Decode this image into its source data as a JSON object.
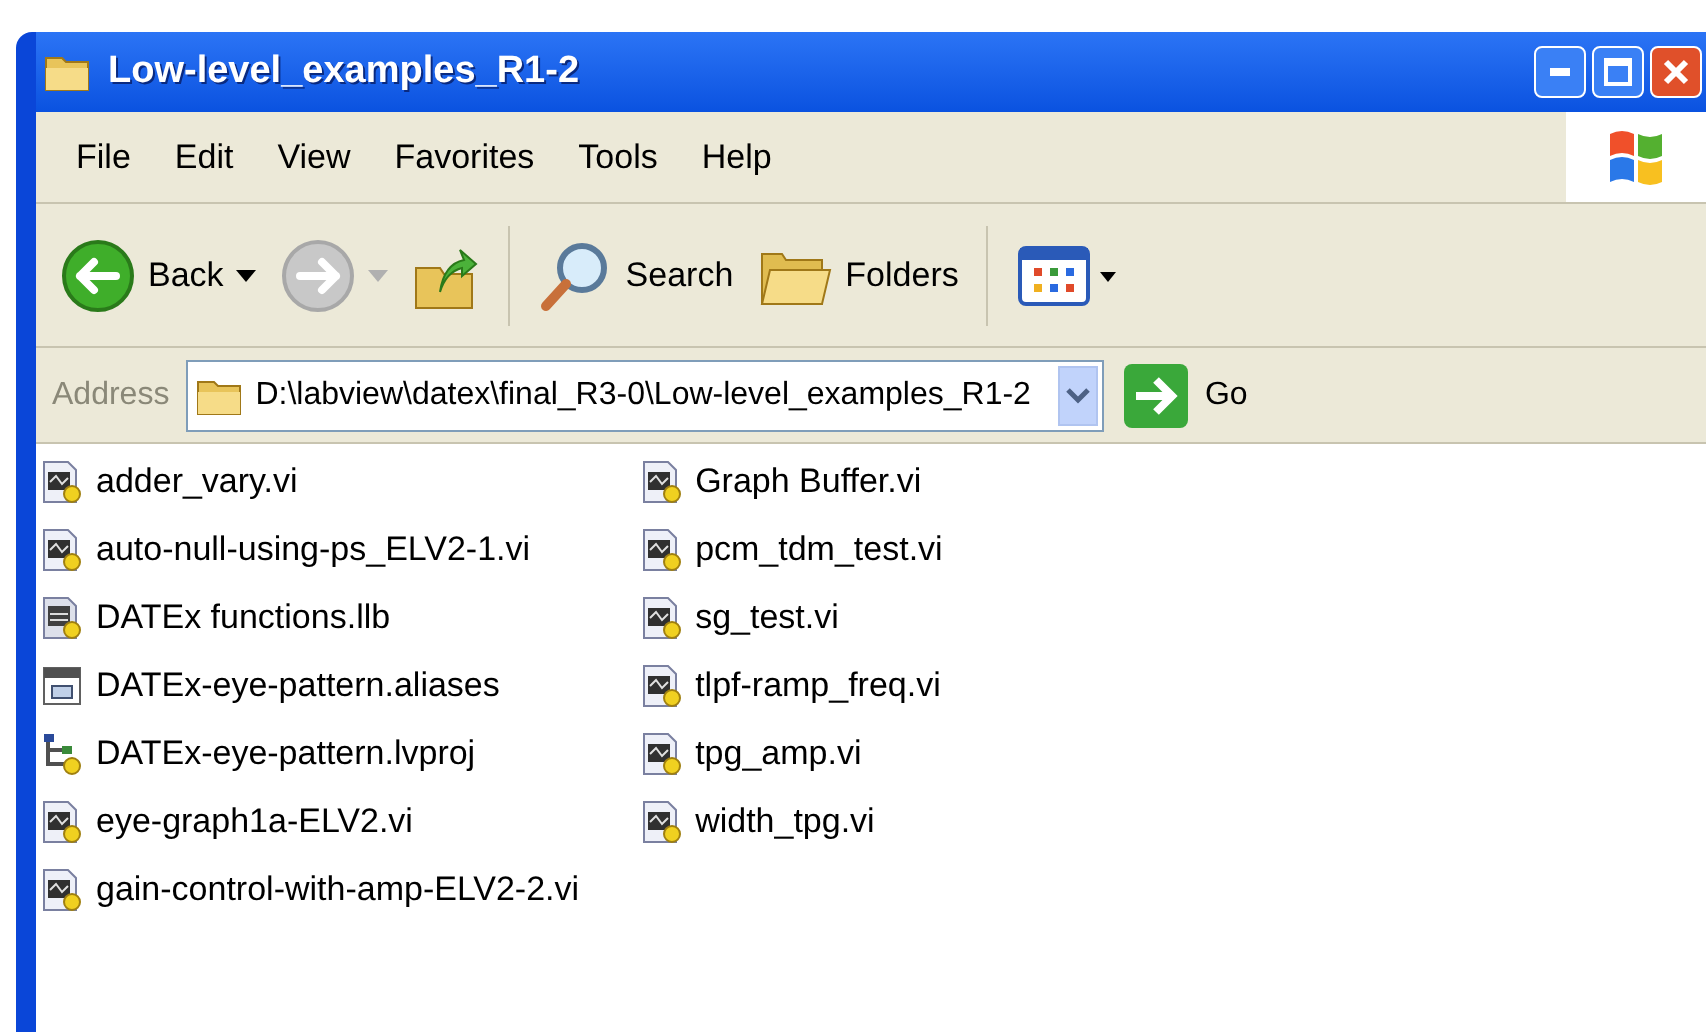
{
  "window": {
    "title": "Low-level_examples_R1-2"
  },
  "menu": [
    "File",
    "Edit",
    "View",
    "Favorites",
    "Tools",
    "Help"
  ],
  "toolbar": [
    {
      "kind": "back",
      "label": "Back"
    },
    {
      "kind": "forward",
      "disabled": true
    },
    {
      "kind": "up"
    },
    {
      "kind": "search",
      "label": "Search"
    },
    {
      "kind": "folders",
      "label": "Folders"
    },
    {
      "kind": "views"
    }
  ],
  "address": {
    "label": "Address",
    "value": "D:\\labview\\datex\\final_R3-0\\Low-level_examples_R1-2",
    "go": "Go"
  },
  "files": [
    {
      "name": "adder_vary.vi",
      "kind": "vi"
    },
    {
      "name": "auto-null-using-ps_ELV2-1.vi",
      "kind": "vi"
    },
    {
      "name": "DATEx functions.llb",
      "kind": "llb"
    },
    {
      "name": "DATEx-eye-pattern.aliases",
      "kind": "aliases"
    },
    {
      "name": "DATEx-eye-pattern.lvproj",
      "kind": "lvproj"
    },
    {
      "name": "eye-graph1a-ELV2.vi",
      "kind": "vi"
    },
    {
      "name": "gain-control-with-amp-ELV2-2.vi",
      "kind": "vi"
    },
    {
      "name": "Graph Buffer.vi",
      "kind": "vi"
    },
    {
      "name": "pcm_tdm_test.vi",
      "kind": "vi"
    },
    {
      "name": "sg_test.vi",
      "kind": "vi"
    },
    {
      "name": "tlpf-ramp_freq.vi",
      "kind": "vi"
    },
    {
      "name": "tpg_amp.vi",
      "kind": "vi"
    },
    {
      "name": "width_tpg.vi",
      "kind": "vi"
    }
  ]
}
